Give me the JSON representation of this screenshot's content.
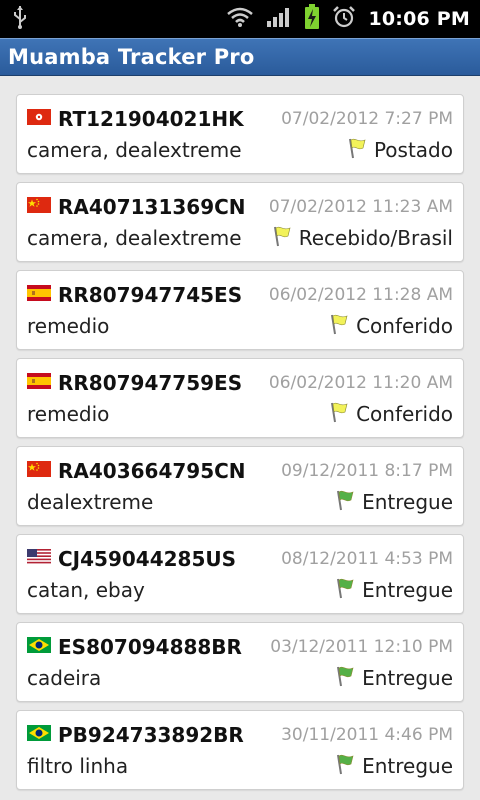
{
  "status_bar": {
    "time": "10:06 PM"
  },
  "app": {
    "title": "Muamba Tracker Pro"
  },
  "colors": {
    "yellow_flag": "#f2f25a",
    "green_flag": "#55b047",
    "title_bar": "#2f63a6"
  },
  "items": [
    {
      "country": "HK",
      "code": "RT121904021HK",
      "date": "07/02/2012  7:27 PM",
      "description": "camera, dealextreme",
      "status": "Postado",
      "flag_color": "yellow"
    },
    {
      "country": "CN",
      "code": "RA407131369CN",
      "date": "07/02/2012  11:23 AM",
      "description": "camera, dealextreme",
      "status": "Recebido/Brasil",
      "flag_color": "yellow"
    },
    {
      "country": "ES",
      "code": "RR807947745ES",
      "date": "06/02/2012  11:28 AM",
      "description": "remedio",
      "status": "Conferido",
      "flag_color": "yellow"
    },
    {
      "country": "ES",
      "code": "RR807947759ES",
      "date": "06/02/2012  11:20 AM",
      "description": "remedio",
      "status": "Conferido",
      "flag_color": "yellow"
    },
    {
      "country": "CN",
      "code": "RA403664795CN",
      "date": "09/12/2011  8:17 PM",
      "description": "dealextreme",
      "status": "Entregue",
      "flag_color": "green"
    },
    {
      "country": "US",
      "code": "CJ459044285US",
      "date": "08/12/2011  4:53 PM",
      "description": "catan, ebay",
      "status": "Entregue",
      "flag_color": "green"
    },
    {
      "country": "BR",
      "code": "ES807094888BR",
      "date": "03/12/2011  12:10 PM",
      "description": "cadeira",
      "status": "Entregue",
      "flag_color": "green"
    },
    {
      "country": "BR",
      "code": "PB924733892BR",
      "date": "30/11/2011  4:46 PM",
      "description": "filtro linha",
      "status": "Entregue",
      "flag_color": "green"
    }
  ]
}
